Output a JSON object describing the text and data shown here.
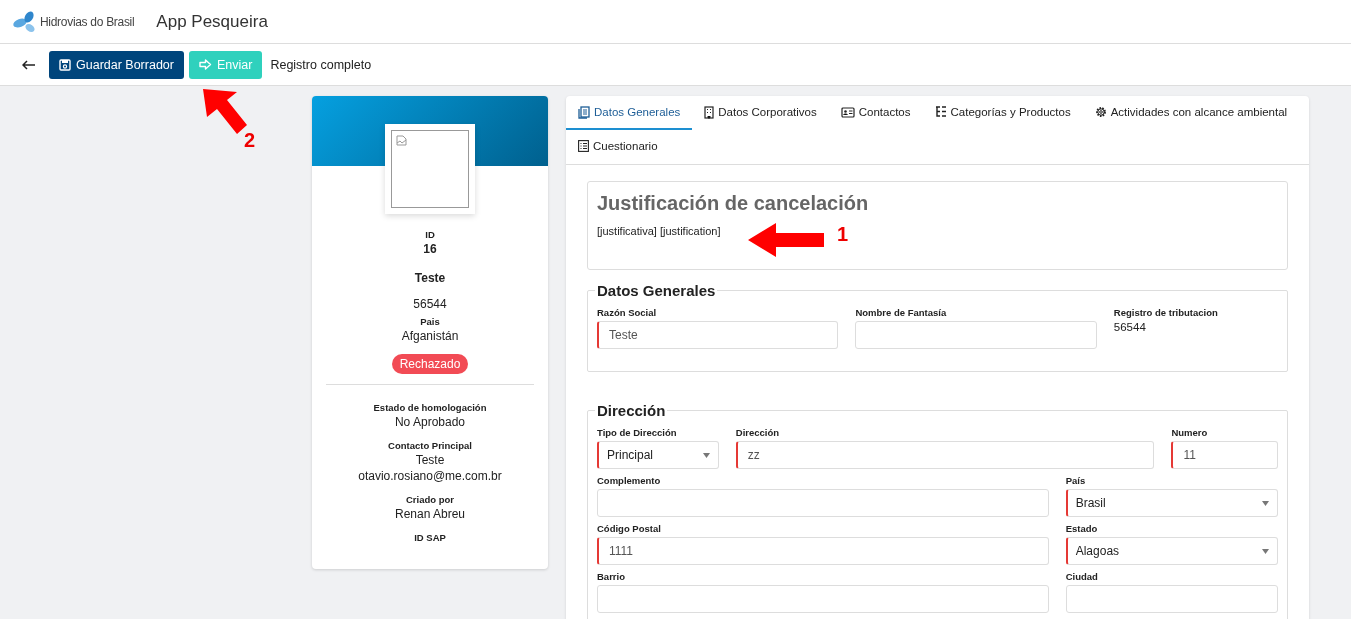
{
  "header": {
    "logo_text": "Hidrovias do Brasil",
    "app_title": "App Pesqueira"
  },
  "toolbar": {
    "buttons": [
      {
        "label": "Guardar Borrador",
        "kind": "save"
      },
      {
        "label": "Enviar",
        "kind": "send"
      }
    ],
    "status": "Registro completo"
  },
  "profile": {
    "id_label": "ID",
    "id": "16",
    "name": "Teste",
    "tax_id": "56544",
    "country_label": "Pais",
    "country": "Afganistán",
    "status_badge": "Rechazado",
    "details": [
      {
        "label": "Estado de homologación",
        "values": [
          "No Aprobado"
        ]
      },
      {
        "label": "Contacto Principal",
        "values": [
          "Teste",
          "otavio.rosiano@me.com.br"
        ]
      },
      {
        "label": "Criado por",
        "values": [
          "Renan Abreu"
        ]
      },
      {
        "label": "ID SAP"
      }
    ]
  },
  "tabs": [
    {
      "label": "Datos Generales",
      "selected": true
    },
    {
      "label": "Datos Corporativos",
      "selected": false
    },
    {
      "label": "Contactos",
      "selected": false
    },
    {
      "label": "Categorías y Productos",
      "selected": false
    },
    {
      "label": "Actividades con alcance ambiental",
      "selected": false
    },
    {
      "label": "Cuestionario",
      "selected": false
    }
  ],
  "justification": {
    "title": "Justificación de cancelación",
    "text": "[justificativa] [justification]"
  },
  "sections": [
    {
      "title": "Datos Generales",
      "rows": [
        [
          {
            "label": "Razón Social",
            "kind": "input",
            "value": "Teste",
            "required": true
          },
          {
            "label": "Nombre de Fantasía",
            "kind": "input",
            "required": false
          },
          {
            "label": "Registro de tributacion",
            "kind": "text",
            "value": "56544"
          }
        ]
      ]
    },
    {
      "title": "Dirección",
      "rows": [
        [
          {
            "label": "Tipo de Dirección",
            "kind": "select",
            "value": "Principal",
            "required": true
          },
          {
            "label": "Dirección",
            "kind": "input",
            "value": "zz",
            "required": true
          },
          {
            "label": "Numero",
            "kind": "input",
            "value": "11",
            "required": true
          }
        ],
        [
          {
            "label": "Complemento",
            "kind": "input",
            "required": false
          },
          {
            "label": "País",
            "kind": "select",
            "value": "Brasil",
            "required": true
          }
        ],
        [
          {
            "label": "Código Postal",
            "kind": "input",
            "value": "1111",
            "required": true
          },
          {
            "label": "Estado",
            "kind": "select",
            "value": "Alagoas",
            "required": true
          }
        ],
        [
          {
            "label": "Barrio",
            "kind": "input",
            "required": false
          },
          {
            "label": "Ciudad",
            "kind": "input",
            "required": false
          }
        ]
      ]
    }
  ],
  "annotations": [
    {
      "label": "1",
      "kind": "left"
    },
    {
      "label": "2",
      "kind": "up-left"
    }
  ]
}
